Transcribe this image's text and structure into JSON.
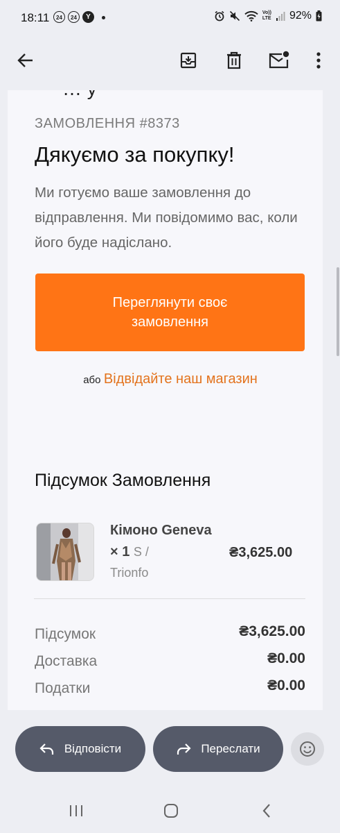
{
  "status_bar": {
    "time": "18:11",
    "badges": [
      "24",
      "24"
    ],
    "y_badge": "Y",
    "volte": "Vo))\nLTE",
    "battery_text": "92%"
  },
  "toolbar": {
    "icons": [
      "back-arrow-icon",
      "archive-icon",
      "delete-icon",
      "mark-unread-icon",
      "more-vert-icon"
    ]
  },
  "email": {
    "cut_text": "… у",
    "order_number": "ЗАМОВЛЕННЯ #8373",
    "title": "Дякуємо за покупку!",
    "lead": "Ми готуємо ваше замовлення до відправлення. Ми повідомимо вас, коли його буде надіслано.",
    "cta_label": "Переглянути своє замовлення",
    "alt_prefix": "або",
    "alt_link": "Відвідайте наш магазин",
    "accent_color": "#ff7415",
    "summary_title": "Підсумок Замовлення",
    "product": {
      "name": "Кімоно Geneva × 1",
      "variant": "S /",
      "store": "Trionfo",
      "price": "₴3,625.00"
    },
    "totals": [
      {
        "label": "Підсумок",
        "value": "₴3,625.00"
      },
      {
        "label": "Доставка",
        "value": "₴0.00"
      },
      {
        "label": "Податки",
        "value": "₴0.00"
      }
    ]
  },
  "actions": {
    "reply_label": "Відповісти",
    "forward_label": "Переслати"
  }
}
